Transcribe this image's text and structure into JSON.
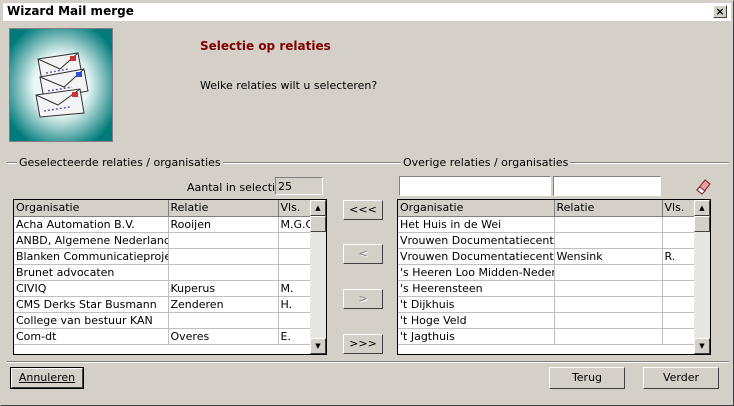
{
  "window": {
    "title": "Wizard Mail merge",
    "close_label": "×"
  },
  "banner": {
    "heading": "Selectie op relaties",
    "question": "Welke relaties wilt u selecteren?",
    "image_icon": "envelopes-icon"
  },
  "left": {
    "group_label": "Geselecteerde relaties / organisaties",
    "count_label": "Aantal in selectie:",
    "count_value": "25",
    "columns": [
      "Organisatie",
      "Relatie",
      "Vls."
    ],
    "rows": [
      [
        "Acha Automation B.V.",
        "Rooijen",
        "M.G.C"
      ],
      [
        "ANBD, Algemene Nederlandse B",
        "",
        ""
      ],
      [
        "Blanken Communicatieprojecten",
        "",
        ""
      ],
      [
        "Brunet advocaten",
        "",
        ""
      ],
      [
        "CIVIQ",
        "Kuperus",
        "M."
      ],
      [
        "CMS Derks Star Busmann",
        "Zenderen",
        "H."
      ],
      [
        "College van bestuur KAN",
        "",
        ""
      ],
      [
        "Com-dt",
        "Overes",
        "E."
      ]
    ]
  },
  "right": {
    "group_label": "Overige relaties / organisaties",
    "filter1_value": "",
    "filter2_value": "",
    "columns": [
      "Organisatie",
      "Relatie",
      "Vls."
    ],
    "rows": [
      [
        "Het Huis in de Wei",
        "",
        ""
      ],
      [
        "Vrouwen Documentatiecentrum",
        "",
        ""
      ],
      [
        "Vrouwen Documentatiecentrum",
        "Wensink",
        "R."
      ],
      [
        "'s Heeren Loo Midden-Nederland",
        "",
        ""
      ],
      [
        "'s Heerensteen",
        "",
        ""
      ],
      [
        "'t Dijkhuis",
        "",
        ""
      ],
      [
        "'t Hoge Veld",
        "",
        ""
      ],
      [
        "'t Jagthuis",
        "",
        ""
      ]
    ]
  },
  "transfer": {
    "all_left": "<<<",
    "one_left": "<",
    "one_right": ">",
    "all_right": ">>>"
  },
  "footer": {
    "cancel": "Annuleren",
    "back": "Terug",
    "next": "Verder"
  },
  "icons": {
    "eraser": "eraser-icon",
    "scroll_up": "arrow-up-icon",
    "scroll_down": "arrow-down-icon"
  }
}
